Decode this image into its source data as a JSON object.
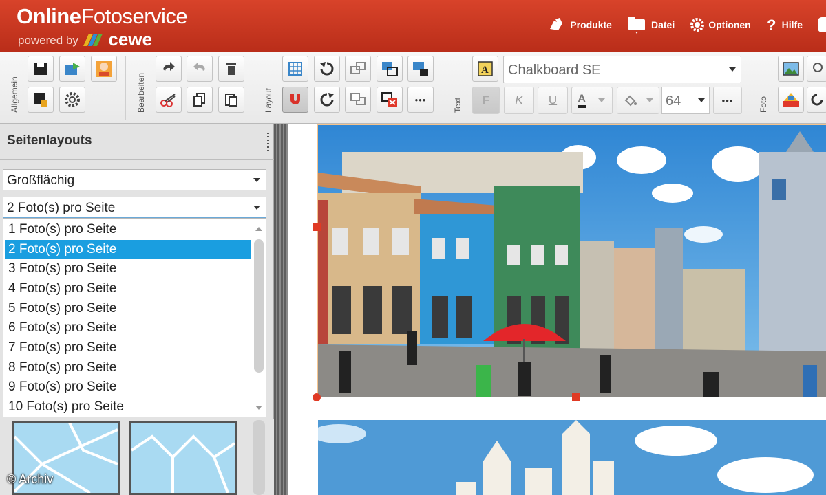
{
  "header": {
    "title_bold": "Online",
    "title_light": "Fotoservice",
    "subtitle": "powered by",
    "partner": "cewe",
    "nav": [
      {
        "label": "Produkte",
        "icon": "hand-icon"
      },
      {
        "label": "Datei",
        "icon": "folder-icon"
      },
      {
        "label": "Optionen",
        "icon": "gear-icon"
      },
      {
        "label": "Hilfe",
        "icon": "question-icon"
      }
    ]
  },
  "toolbar": {
    "groups": [
      "Allgemein",
      "Bearbeiten",
      "Layout",
      "Text",
      "Foto"
    ],
    "font_name": "Chalkboard SE",
    "font_size": "64",
    "bold": "F",
    "italic": "K",
    "underline": "U",
    "color_letter": "A",
    "more": "•••"
  },
  "panel": {
    "title": "Seitenlayouts",
    "style_select": "Großflächig",
    "count_select": "2 Foto(s) pro Seite",
    "options": [
      "1 Foto(s) pro Seite",
      "2 Foto(s) pro Seite",
      "3 Foto(s) pro Seite",
      "4 Foto(s) pro Seite",
      "5 Foto(s) pro Seite",
      "6 Foto(s) pro Seite",
      "7 Foto(s) pro Seite",
      "8 Foto(s) pro Seite",
      "9 Foto(s) pro Seite",
      "10 Foto(s) pro Seite"
    ],
    "selected_index": 1
  },
  "watermark": "© Archiv",
  "colors": {
    "brand": "#c8361f",
    "selection": "#1a9ee0",
    "sky": "#4f9ad6"
  }
}
